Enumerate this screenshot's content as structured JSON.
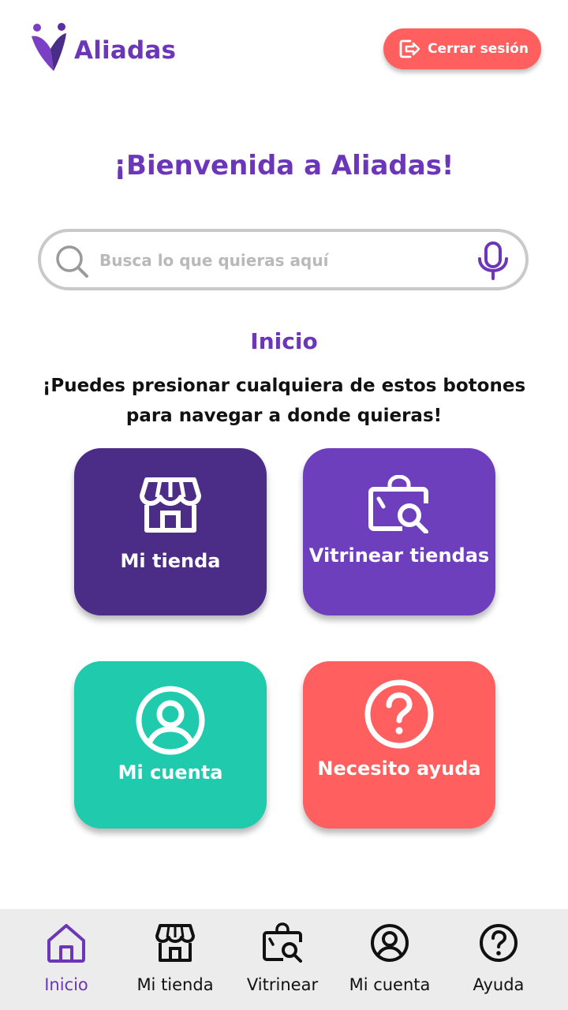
{
  "app": {
    "name": "Aliadas"
  },
  "header": {
    "logout_label": "Cerrar sesión"
  },
  "welcome": "¡Bienvenida a Aliadas!",
  "search": {
    "placeholder": "Busca lo que quieras aquí",
    "value": ""
  },
  "section": {
    "title": "Inicio",
    "instructions": "¡Puedes presionar cualquiera de estos botones para navegar a donde quieras!"
  },
  "tiles": [
    {
      "label": "Mi tienda",
      "icon": "store-icon",
      "color": "#4b2d87"
    },
    {
      "label": "Vitrinear tiendas",
      "icon": "shopping-bag-search-icon",
      "color": "#6e3fbd"
    },
    {
      "label": "Mi cuenta",
      "icon": "user-circle-icon",
      "color": "#1fcbac"
    },
    {
      "label": "Necesito ayuda",
      "icon": "help-circle-icon",
      "color": "#ff5f5f"
    }
  ],
  "bottom_nav": [
    {
      "label": "Inicio",
      "icon": "home-icon",
      "active": true
    },
    {
      "label": "Mi tienda",
      "icon": "store-icon",
      "active": false
    },
    {
      "label": "Vitrinear",
      "icon": "shopping-bag-search-icon",
      "active": false
    },
    {
      "label": "Mi cuenta",
      "icon": "user-circle-icon",
      "active": false
    },
    {
      "label": "Ayuda",
      "icon": "help-circle-icon",
      "active": false
    }
  ],
  "colors": {
    "brand_purple": "#6b36b8",
    "dark_purple": "#4b2d87",
    "teal": "#1fcbac",
    "coral": "#ff5f5f",
    "nav_background": "#ececec"
  }
}
